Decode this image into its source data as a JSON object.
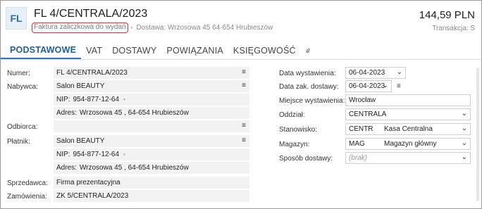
{
  "header": {
    "logo": "FL",
    "title": "FL 4/CENTRALA/2023",
    "doc_type": "Faktura zaliczkowa do wydań",
    "delivery": "Dostawa: Wrzosowa 45 64-654 Hrubieszów",
    "amount": "144,59 PLN",
    "transaction": "Transakcja: S"
  },
  "tabs": [
    {
      "label": "PODSTAWOWE",
      "active": true
    },
    {
      "label": "VAT"
    },
    {
      "label": "DOSTAWY"
    },
    {
      "label": "POWIĄZANIA"
    },
    {
      "label": "KSIĘGOWOŚĆ"
    }
  ],
  "left": {
    "numer_label": "Numer:",
    "numer_value": "FL 4/CENTRALA/2023",
    "nabywca_label": "Nabywca:",
    "nabywca_value": "Salon BEAUTY",
    "nabywca_nip_key": "NIP:",
    "nabywca_nip": "954-877-12-64",
    "nabywca_adres_key": "Adres:",
    "nabywca_adres": "Wrzosowa 45 , 64-654 Hrubieszów",
    "odbiorca_label": "Odbiorca:",
    "odbiorca_value": "",
    "platnik_label": "Płatnik:",
    "platnik_value": "Salon BEAUTY",
    "platnik_nip_key": "NIP:",
    "platnik_nip": "954-877-12-64",
    "platnik_adres_key": "Adres:",
    "platnik_adres": "Wrzosowa 45 , 64-654 Hrubieszów",
    "sprzedawca_label": "Sprzedawca:",
    "sprzedawca_value": "Firma prezentacyjna",
    "zamowienia_label": "Zamówienia:",
    "zamowienia_value": "ZK 5/CENTRALA/2023"
  },
  "right": {
    "data_wyst_label": "Data wystawienia:",
    "data_wyst": "06-04-2023",
    "data_zak_label": "Data zak. dostawy:",
    "data_zak": "06-04-2023",
    "miejsce_label": "Miejsce wystawienia:",
    "miejsce": "Wrocław",
    "oddzial_label": "Oddział:",
    "oddzial": "CENTRALA",
    "stanowisko_label": "Stanowisko:",
    "stanowisko_code": "CENTR",
    "stanowisko_name": "Kasa Centralna",
    "magazyn_label": "Magazyn:",
    "magazyn_code": "MAG",
    "magazyn_name": "Magazyn główny",
    "sposob_label": "Sposób dostawy:",
    "sposob": "(brak)"
  },
  "icons": {
    "menu": "≡",
    "chevron": "⌄",
    "bullet": "•"
  },
  "colors": {
    "accent": "#1f5f96",
    "highlight_border": "#e03030",
    "field_bg": "#f2f2f2"
  }
}
